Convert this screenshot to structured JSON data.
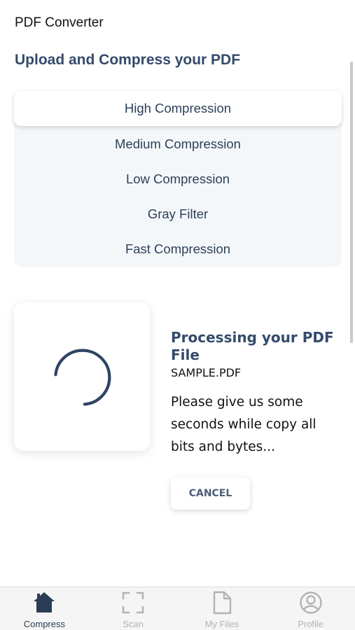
{
  "header": {
    "app_title": "PDF Converter",
    "page_heading": "Upload and Compress your PDF"
  },
  "compression_options": {
    "items": [
      {
        "label": "High Compression",
        "selected": true
      },
      {
        "label": "Medium Compression",
        "selected": false
      },
      {
        "label": "Low Compression",
        "selected": false
      },
      {
        "label": "Gray Filter",
        "selected": false
      },
      {
        "label": "Fast Compression",
        "selected": false
      }
    ]
  },
  "processing": {
    "spinner_icon": "loading-spinner-icon",
    "title": "Processing your PDF File",
    "filename": "SAMPLE.PDF",
    "message": "Please give us some seconds while copy all bits and bytes...",
    "cancel_label": "CANCEL"
  },
  "tabbar": {
    "tabs": [
      {
        "label": "Compress",
        "icon": "home-icon",
        "active": true
      },
      {
        "label": "Scan",
        "icon": "scan-icon",
        "active": false
      },
      {
        "label": "My Files",
        "icon": "file-icon",
        "active": false
      },
      {
        "label": "Profile",
        "icon": "profile-icon",
        "active": false
      }
    ]
  },
  "colors": {
    "accent": "#344a6b",
    "inactive_tab": "#b3b3b3",
    "options_background": "#f4f7fa"
  }
}
